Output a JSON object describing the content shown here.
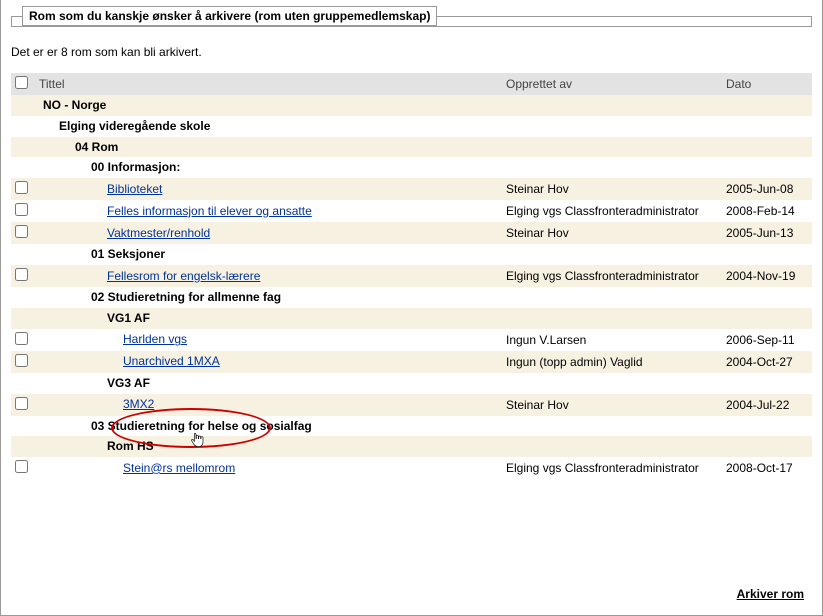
{
  "legend": "Rom som du kanskje ønsker å arkivere (rom uten gruppemedlemskap)",
  "intro": "Det er er 8 rom som kan bli arkivert.",
  "columns": {
    "title": "Tittel",
    "creator": "Opprettet av",
    "date": "Dato"
  },
  "rows": [
    {
      "indent": 0,
      "kind": "folder",
      "checkbox": false,
      "title": "NO - Norge",
      "creator": "",
      "date": ""
    },
    {
      "indent": 1,
      "kind": "folder",
      "checkbox": false,
      "title": "Elging videregående skole",
      "creator": "",
      "date": ""
    },
    {
      "indent": 2,
      "kind": "folder",
      "checkbox": false,
      "title": "04 Rom",
      "creator": "",
      "date": ""
    },
    {
      "indent": 3,
      "kind": "folder",
      "checkbox": false,
      "title": "00 Informasjon:",
      "creator": "",
      "date": ""
    },
    {
      "indent": 4,
      "kind": "room",
      "checkbox": true,
      "title": "Biblioteket",
      "creator": "Steinar Hov",
      "date": "2005-Jun-08"
    },
    {
      "indent": 4,
      "kind": "room",
      "checkbox": true,
      "title": "Felles informasjon til elever og ansatte",
      "creator": "Elging vgs Classfronteradministrator",
      "date": "2008-Feb-14"
    },
    {
      "indent": 4,
      "kind": "room",
      "checkbox": true,
      "title": "Vaktmester/renhold",
      "creator": "Steinar Hov",
      "date": "2005-Jun-13"
    },
    {
      "indent": 3,
      "kind": "folder",
      "checkbox": false,
      "title": "01 Seksjoner",
      "creator": "",
      "date": ""
    },
    {
      "indent": 4,
      "kind": "room",
      "checkbox": true,
      "title": "Fellesrom for engelsk-lærere",
      "creator": "Elging vgs Classfronteradministrator",
      "date": "2004-Nov-19"
    },
    {
      "indent": 3,
      "kind": "folder",
      "checkbox": false,
      "title": "02 Studieretning for allmenne fag",
      "creator": "",
      "date": ""
    },
    {
      "indent": 4,
      "kind": "folder",
      "checkbox": false,
      "title": "VG1 AF",
      "creator": "",
      "date": ""
    },
    {
      "indent": 5,
      "kind": "room",
      "checkbox": true,
      "title": "Harlden vgs",
      "creator": "Ingun V.Larsen",
      "date": "2006-Sep-11"
    },
    {
      "indent": 5,
      "kind": "room",
      "checkbox": true,
      "title": "Unarchived 1MXA",
      "creator": "Ingun (topp admin) Vaglid",
      "date": "2004-Oct-27"
    },
    {
      "indent": 4,
      "kind": "folder",
      "checkbox": false,
      "title": "VG3 AF",
      "creator": "",
      "date": ""
    },
    {
      "indent": 5,
      "kind": "room",
      "checkbox": true,
      "title": "3MX2",
      "creator": "Steinar Hov",
      "date": "2004-Jul-22"
    },
    {
      "indent": 3,
      "kind": "folder",
      "checkbox": false,
      "title": "03 Studieretning for helse og sosialfag",
      "creator": "",
      "date": ""
    },
    {
      "indent": 4,
      "kind": "folder",
      "checkbox": false,
      "title": "Rom HS",
      "creator": "",
      "date": ""
    },
    {
      "indent": 5,
      "kind": "room",
      "checkbox": true,
      "title": "Stein@rs mellomrom",
      "creator": "Elging vgs Classfronteradministrator",
      "date": "2008-Oct-17"
    }
  ],
  "footer": "Arkiver rom"
}
